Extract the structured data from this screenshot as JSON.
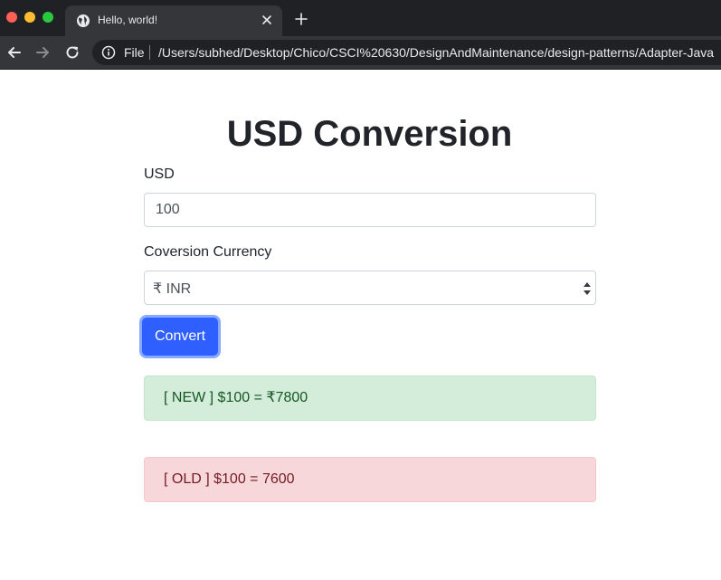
{
  "browser": {
    "tab_title": "Hello, world!",
    "address_scheme": "File",
    "url": "/Users/subhed/Desktop/Chico/CSCI%20630/DesignAndMaintenance/design-patterns/Adapter-Java"
  },
  "page": {
    "heading": "USD Conversion",
    "usd_label": "USD",
    "usd_value": "100",
    "currency_label": "Coversion Currency",
    "currency_selected": "₹ INR",
    "convert_button": "Convert",
    "result_new": "[ NEW ] $100 = ₹7800",
    "result_old": "[ OLD ] $100 = 7600"
  },
  "colors": {
    "primary": "#2f5fff",
    "success_bg": "#d4edda",
    "danger_bg": "#f8d7da"
  },
  "icons": [
    "globe-icon",
    "close-icon",
    "plus-icon",
    "arrow-left-icon",
    "arrow-right-icon",
    "reload-icon",
    "info-icon",
    "select-arrows-icon"
  ]
}
